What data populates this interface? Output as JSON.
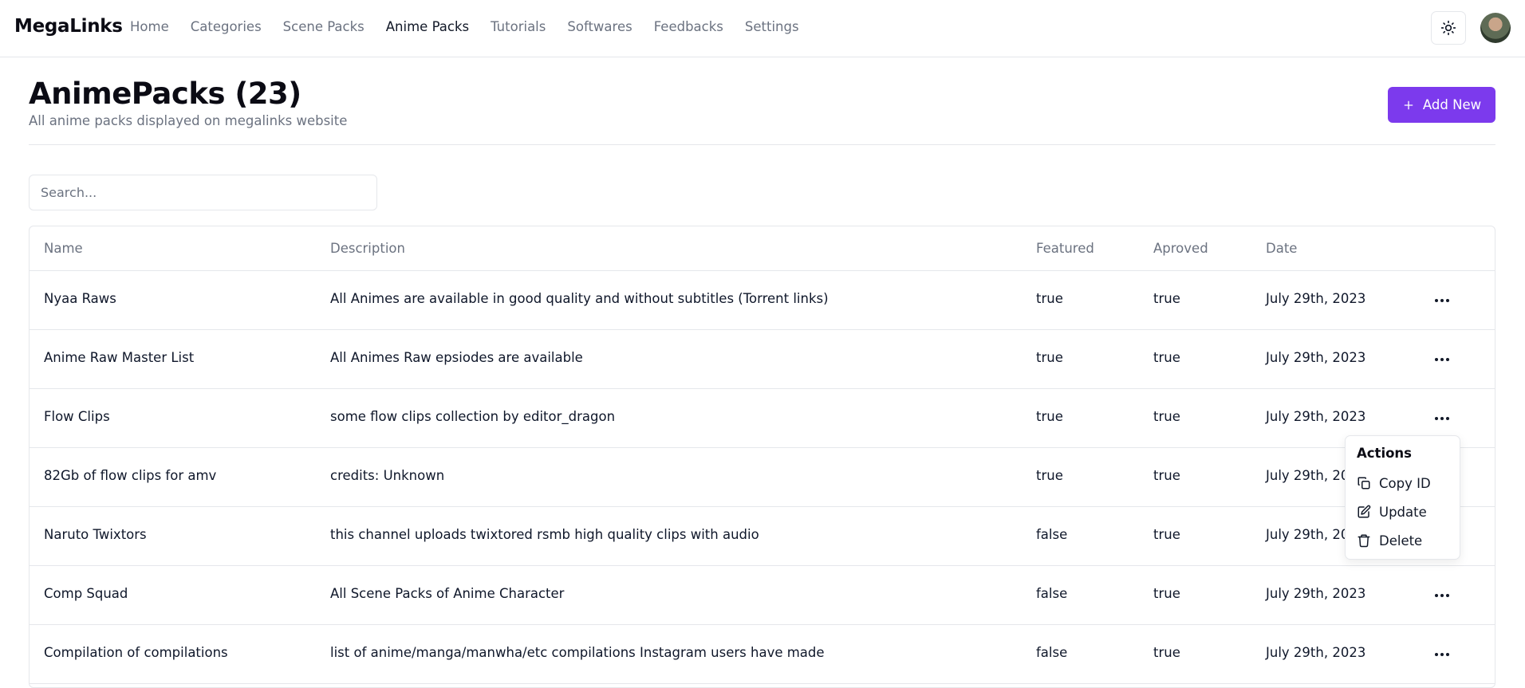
{
  "nav": {
    "brand": "MegaLinks",
    "links": [
      {
        "label": "Home"
      },
      {
        "label": "Categories"
      },
      {
        "label": "Scene Packs"
      },
      {
        "label": "Anime Packs",
        "active": true
      },
      {
        "label": "Tutorials"
      },
      {
        "label": "Softwares"
      },
      {
        "label": "Feedbacks"
      },
      {
        "label": "Settings"
      }
    ],
    "theme_icon": "sun-icon"
  },
  "header": {
    "title": "AnimePacks (23)",
    "subtitle": "All anime packs displayed on megalinks website",
    "add_label": "Add New"
  },
  "search": {
    "placeholder": "Search..."
  },
  "table": {
    "columns": [
      "Name",
      "Description",
      "Featured",
      "Aproved",
      "Date"
    ],
    "rows": [
      {
        "name": "Nyaa Raws",
        "description": "All Animes are available in good quality and without subtitles (Torrent links)",
        "featured": "true",
        "approved": "true",
        "date": "July 29th, 2023"
      },
      {
        "name": "Anime Raw Master List",
        "description": "All Animes Raw epsiodes are available",
        "featured": "true",
        "approved": "true",
        "date": "July 29th, 2023"
      },
      {
        "name": "Flow Clips",
        "description": "some flow clips collection by editor_dragon",
        "featured": "true",
        "approved": "true",
        "date": "July 29th, 2023"
      },
      {
        "name": "82Gb of flow clips for amv",
        "description": "credits: Unknown",
        "featured": "true",
        "approved": "true",
        "date": "July 29th, 20"
      },
      {
        "name": "Naruto Twixtors",
        "description": "this channel uploads twixtored rsmb high quality clips with audio",
        "featured": "false",
        "approved": "true",
        "date": "July 29th, 20"
      },
      {
        "name": "Comp Squad",
        "description": "All Scene Packs of Anime Character",
        "featured": "false",
        "approved": "true",
        "date": "July 29th, 2023"
      },
      {
        "name": "Compilation of compilations",
        "description": "list of anime/manga/manwha/etc compilations Instagram users have made",
        "featured": "false",
        "approved": "true",
        "date": "July 29th, 2023"
      }
    ]
  },
  "actions_menu": {
    "title": "Actions",
    "items": [
      {
        "label": "Copy ID",
        "icon": "copy-icon"
      },
      {
        "label": "Update",
        "icon": "edit-icon"
      },
      {
        "label": "Delete",
        "icon": "trash-icon"
      }
    ]
  },
  "colors": {
    "accent": "#7c3aed",
    "border": "#e5e7eb",
    "muted": "#6b7280"
  }
}
